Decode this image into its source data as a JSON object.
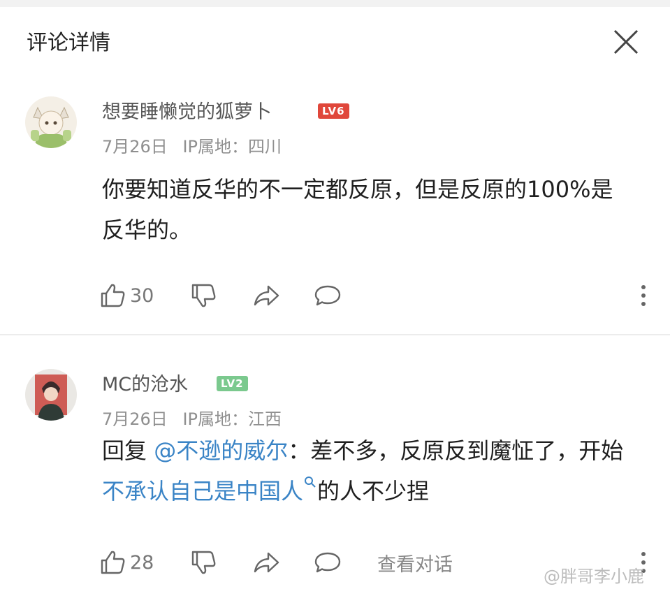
{
  "header": {
    "title": "评论详情",
    "close_icon": "close-icon"
  },
  "comments": [
    {
      "username": "想要睡懒觉的狐萝卜",
      "level": "LV6",
      "level_color": "#e0473b",
      "date": "7月26日",
      "ip": "IP属地：四川",
      "text": "你要知道反华的不一定都反原，但是反原的100%是反华的。",
      "likes": "30"
    },
    {
      "username": "MC的沧水",
      "level": "LV2",
      "level_color": "#7bc98e",
      "date": "7月26日",
      "ip": "IP属地：江西",
      "reply_prefix": "回复",
      "mention": "@不逊的威尔",
      "text_part1": "：差不多，反原反到魔怔了，开始",
      "topic": "不承认自己是中国人",
      "text_part2": "的人不少捏",
      "likes": "28",
      "view_conversation": "查看对话"
    }
  ],
  "watermark": "@胖哥李小鹿",
  "colors": {
    "link": "#3a84c6",
    "meta": "#8f8f8f"
  }
}
